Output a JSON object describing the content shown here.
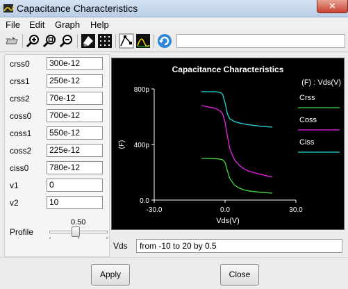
{
  "window": {
    "title": "Capacitance Characteristics",
    "close_glyph": "✕"
  },
  "menu": [
    "File",
    "Edit",
    "Graph",
    "Help"
  ],
  "toolbar": {
    "icons": [
      "open-icon",
      "zoom-in-icon",
      "zoom-fit-icon",
      "zoom-out-icon",
      "color-icon",
      "grid-icon",
      "markers-icon",
      "curve-icon",
      "refresh-icon"
    ],
    "field_value": ""
  },
  "params": [
    {
      "label": "crss0",
      "value": "300e-12"
    },
    {
      "label": "crss1",
      "value": "250e-12"
    },
    {
      "label": "crss2",
      "value": "70e-12"
    },
    {
      "label": "coss0",
      "value": "700e-12"
    },
    {
      "label": "coss1",
      "value": "550e-12"
    },
    {
      "label": "coss2",
      "value": "225e-12"
    },
    {
      "label": "ciss0",
      "value": "780e-12"
    },
    {
      "label": "v1",
      "value": "0"
    },
    {
      "label": "v2",
      "value": "10"
    }
  ],
  "profile": {
    "label": "Profile",
    "value_text": "0.50",
    "value": 0.5
  },
  "chart_data": {
    "type": "line",
    "title": "Capacitance Characteristics",
    "xlabel": "Vds(V)",
    "ylabel": "(F)",
    "legend_title": "(F) : Vds(V)",
    "xlim": [
      -30,
      30
    ],
    "ylim": [
      0,
      8e-10
    ],
    "x_ticks": [
      {
        "value": -30,
        "label": "-30.0"
      },
      {
        "value": 0,
        "label": "0.0"
      },
      {
        "value": 30,
        "label": "30.0"
      }
    ],
    "y_ticks": [
      {
        "value": 0,
        "label": "0.0"
      },
      {
        "value": 4e-10,
        "label": "400p"
      },
      {
        "value": 8e-10,
        "label": "800p"
      }
    ],
    "grid": false,
    "legend_position": "right",
    "series": [
      {
        "name": "Crss",
        "color": "#44dd44",
        "x": [
          -10,
          -4,
          -2,
          -1,
          0,
          1,
          2,
          4,
          6,
          8,
          10,
          15,
          20
        ],
        "y": [
          3e-10,
          2.98e-10,
          2.94e-10,
          2.9e-10,
          2.7e-10,
          2.1e-10,
          1.55e-10,
          1.08e-10,
          8.6e-11,
          7.4e-11,
          6.6e-11,
          5.6e-11,
          5e-11
        ]
      },
      {
        "name": "Coss",
        "color": "#ee22ee",
        "x": [
          -10,
          -4,
          -2,
          -1,
          0,
          1,
          2,
          4,
          6,
          8,
          10,
          15,
          20
        ],
        "y": [
          6.8e-10,
          6.6e-10,
          6.4e-10,
          6.2e-10,
          5.6e-10,
          4.6e-10,
          3.7e-10,
          2.9e-10,
          2.5e-10,
          2.25e-10,
          2.08e-10,
          1.85e-10,
          1.65e-10
        ]
      },
      {
        "name": "Ciss",
        "color": "#22dddd",
        "x": [
          -10,
          -4,
          -2,
          -1,
          0,
          1,
          2,
          4,
          6,
          8,
          10,
          15,
          20
        ],
        "y": [
          7.8e-10,
          7.8e-10,
          7.75e-10,
          7.6e-10,
          7e-10,
          6.2e-10,
          5.85e-10,
          5.65e-10,
          5.55e-10,
          5.48e-10,
          5.42e-10,
          5.32e-10,
          5.25e-10
        ]
      }
    ]
  },
  "sweep": {
    "label": "Vds",
    "value": "from -10 to 20 by 0.5"
  },
  "buttons": {
    "apply": "Apply",
    "close": "Close"
  }
}
